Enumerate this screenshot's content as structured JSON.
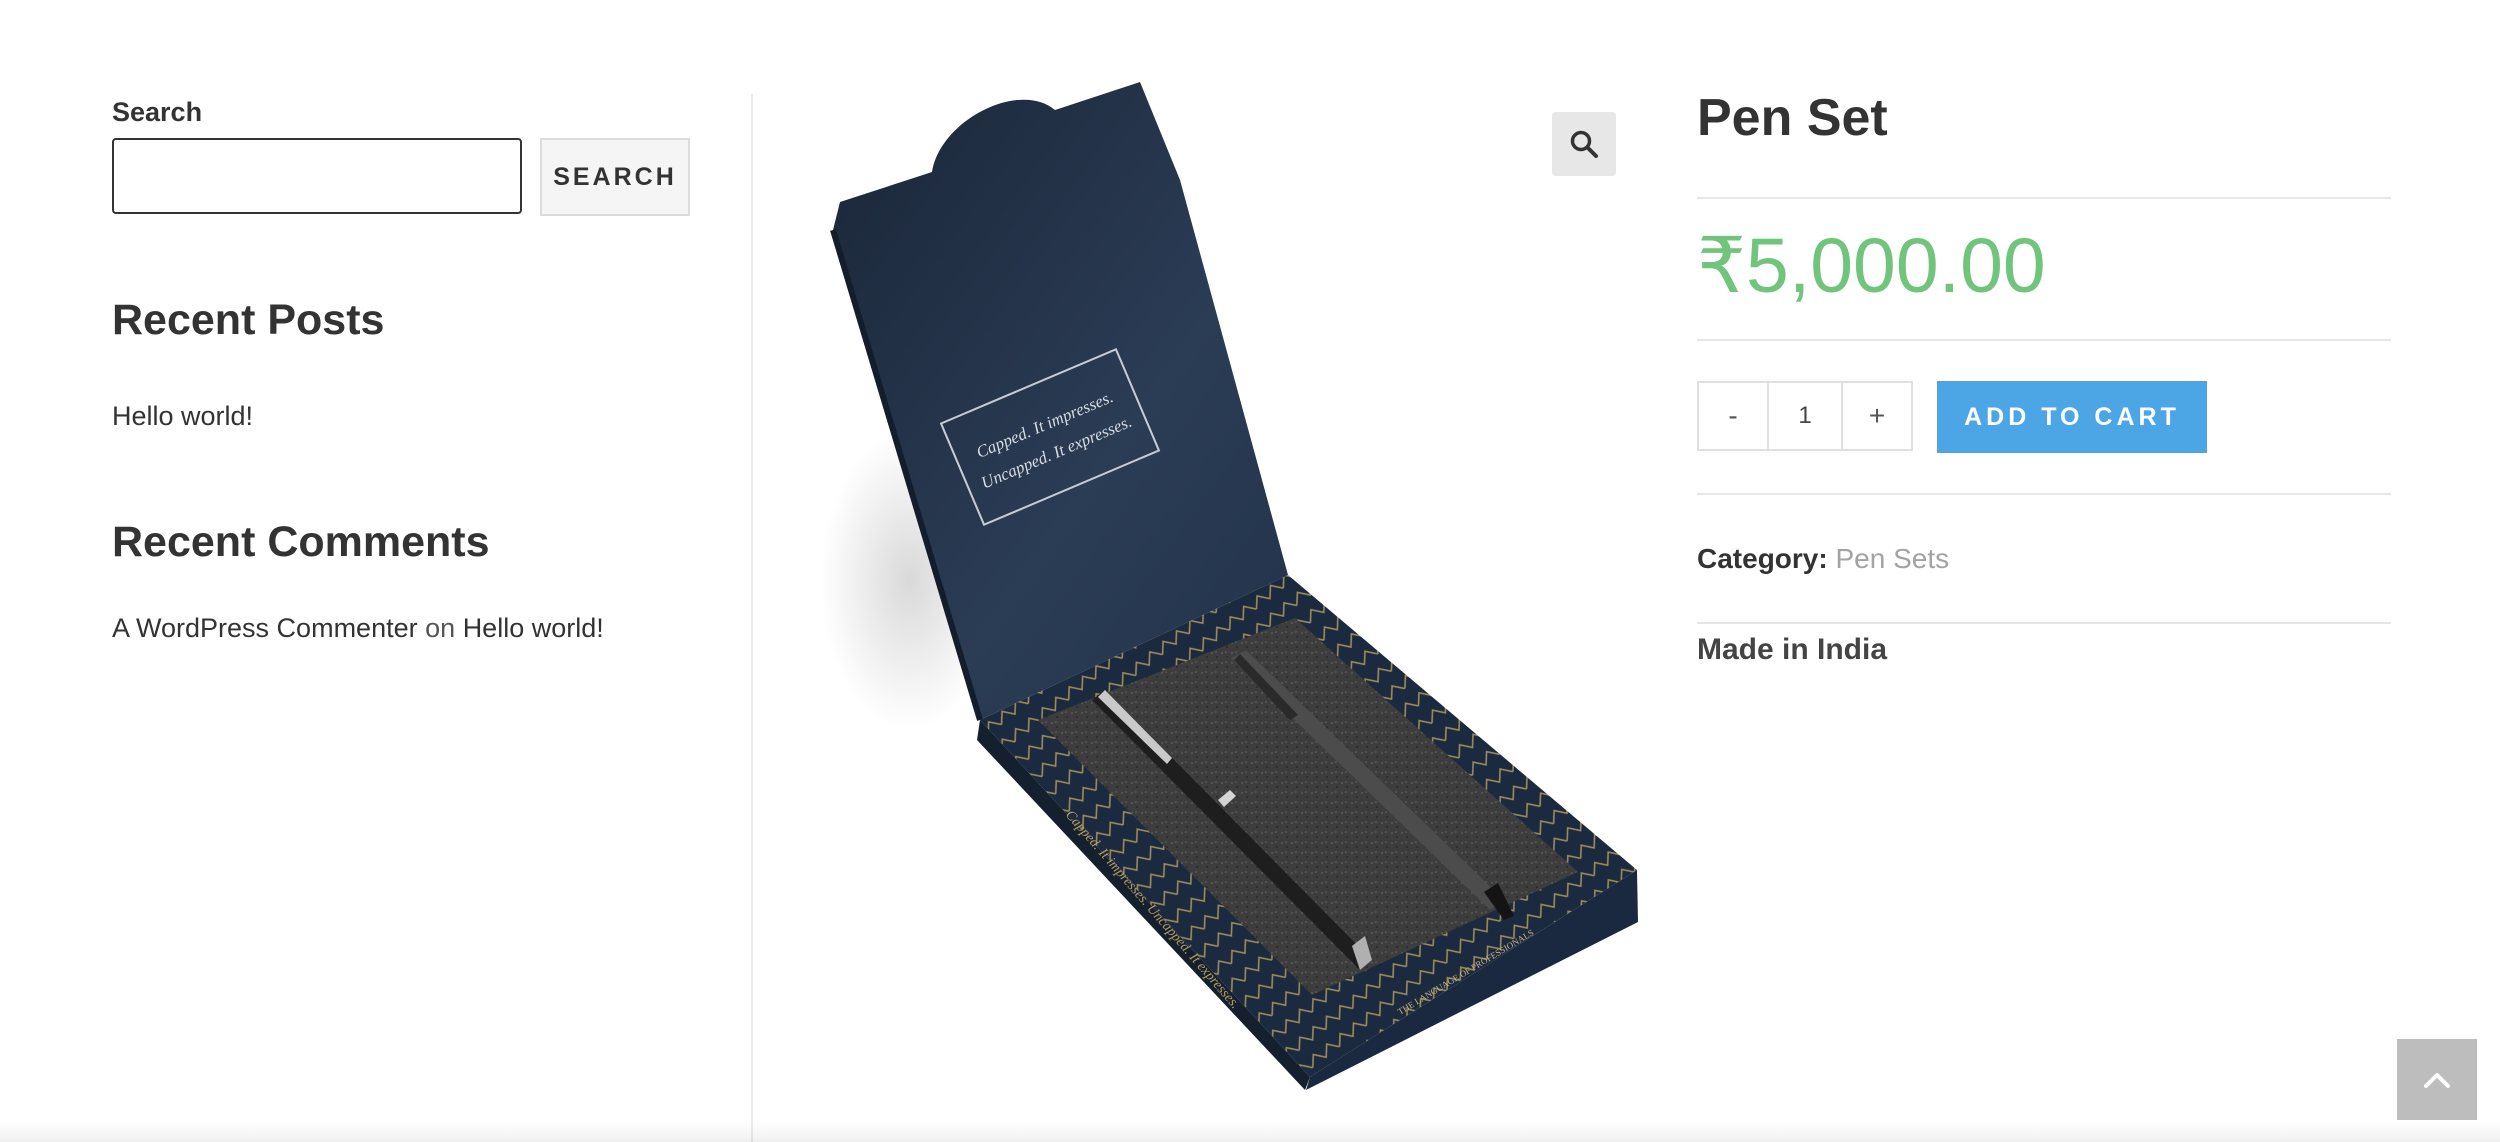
{
  "sidebar": {
    "search": {
      "label": "Search",
      "value": "",
      "placeholder": "",
      "button_label": "SEARCH"
    },
    "recent_posts": {
      "title": "Recent Posts",
      "items": [
        {
          "label": "Hello world!"
        }
      ]
    },
    "recent_comments": {
      "title": "Recent Comments",
      "items": [
        {
          "author": "A WordPress Commenter",
          "connector": "on",
          "post": "Hello world!"
        }
      ]
    }
  },
  "product": {
    "title": "Pen Set",
    "price": "₹5,000.00",
    "quantity": {
      "decrement_label": "-",
      "value": "1",
      "increment_label": "+"
    },
    "add_to_cart_label": "ADD TO CART",
    "category_label": "Category:",
    "category_value": "Pen Sets",
    "made_in": "Made in India",
    "image": {
      "lid_text_line1": "Capped. It impresses.",
      "lid_text_line2": "Uncapped. It expresses.",
      "box_side_text": "Capped. It impresses. Uncapped. It expresses.",
      "box_front_text": "THE LANGUAGE OF PROFESSIONALS"
    }
  },
  "icons": {
    "zoom": "magnifier-icon",
    "scroll_top": "chevron-up-icon"
  },
  "colors": {
    "price": "#70c47c",
    "button": "#4ca6e6",
    "category_link": "#a3a3a3",
    "box_navy": "#1d2b40"
  }
}
